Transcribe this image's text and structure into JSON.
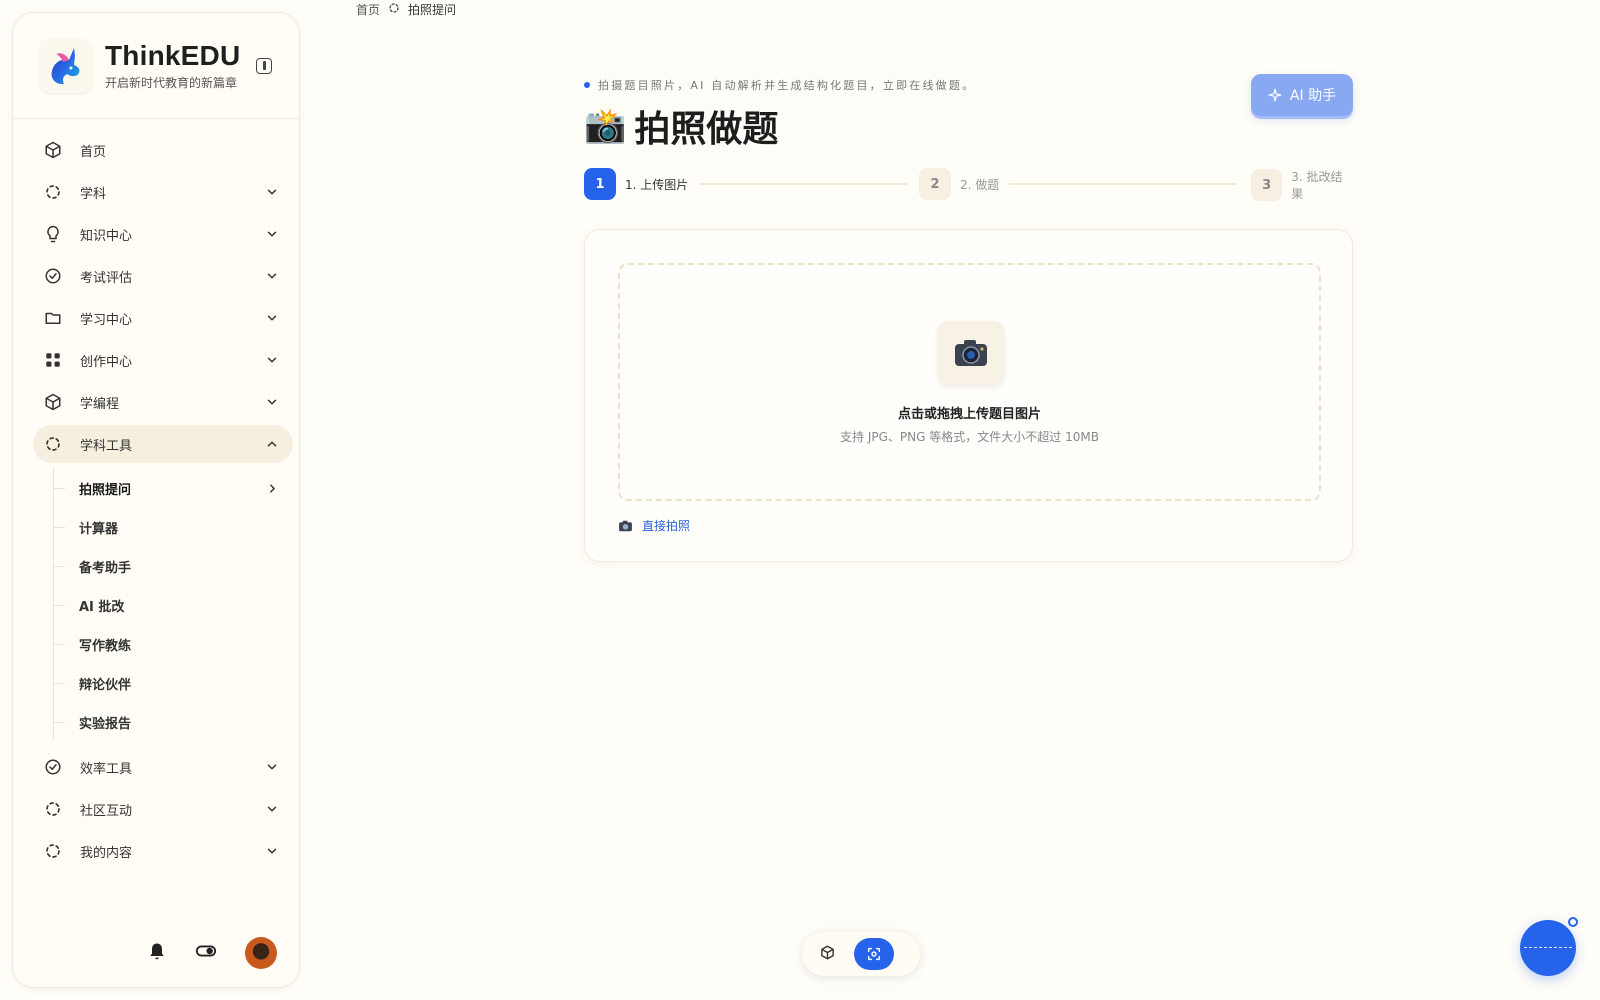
{
  "brand": {
    "name": "ThinkEDU",
    "subtitle": "开启新时代教育的新篇章"
  },
  "breadcrumb": {
    "home": "首页",
    "current": "拍照提问"
  },
  "sidebar": {
    "items": [
      {
        "label": "首页",
        "icon": "cube-icon"
      },
      {
        "label": "学科",
        "icon": "dots-circle-icon"
      },
      {
        "label": "知识中心",
        "icon": "lightbulb-icon"
      },
      {
        "label": "考试评估",
        "icon": "check-circle-icon"
      },
      {
        "label": "学习中心",
        "icon": "folder-icon"
      },
      {
        "label": "创作中心",
        "icon": "grid-icon"
      },
      {
        "label": "学编程",
        "icon": "cube-icon"
      },
      {
        "label": "学科工具",
        "icon": "dots-circle-icon"
      }
    ],
    "subitems": [
      "拍照提问",
      "计算器",
      "备考助手",
      "AI 批改",
      "写作教练",
      "辩论伙伴",
      "实验报告"
    ],
    "items_after": [
      {
        "label": "效率工具",
        "icon": "check-circle-icon"
      },
      {
        "label": "社区互动",
        "icon": "dots-circle-icon"
      },
      {
        "label": "我的内容",
        "icon": "dots-circle-icon"
      }
    ]
  },
  "header": {
    "intro": "拍摄题目照片，AI 自动解析并生成结构化题目，立即在线做题。",
    "title_emoji": "📸",
    "title": "拍照做题",
    "ai_button": "AI 助手"
  },
  "steps": [
    {
      "num": "1",
      "label": "1. 上传图片"
    },
    {
      "num": "2",
      "label": "2. 做题"
    },
    {
      "num": "3",
      "label": "3. 批改结果"
    }
  ],
  "upload": {
    "title": "点击或拖拽上传题目图片",
    "hint": "支持 JPG、PNG 等格式，文件大小不超过 10MB",
    "direct_photo": "直接拍照"
  },
  "colors": {
    "accent": "#2563eb",
    "background": "#fffdf8"
  }
}
